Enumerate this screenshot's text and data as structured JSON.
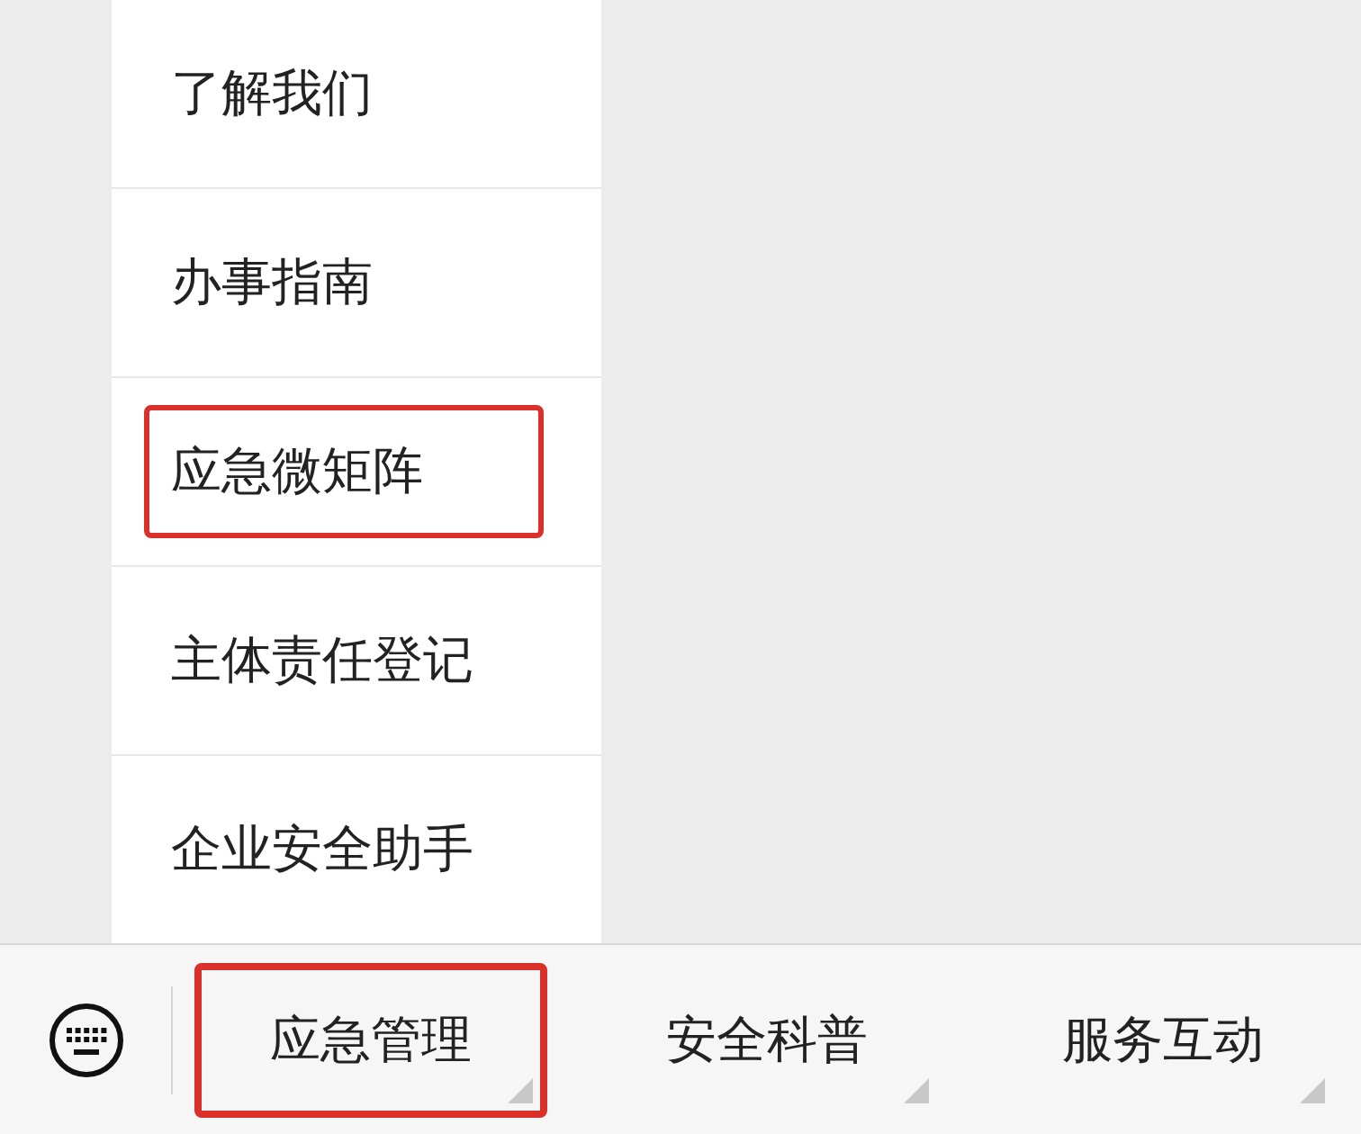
{
  "submenu": {
    "items": [
      {
        "label": "了解我们",
        "highlighted": false
      },
      {
        "label": "办事指南",
        "highlighted": false
      },
      {
        "label": "应急微矩阵",
        "highlighted": true
      },
      {
        "label": "主体责任登记",
        "highlighted": false
      },
      {
        "label": "企业安全助手",
        "highlighted": false
      }
    ]
  },
  "menu_bar": {
    "buttons": [
      {
        "label": "应急管理",
        "highlighted": true
      },
      {
        "label": "安全科普",
        "highlighted": false
      },
      {
        "label": "服务互动",
        "highlighted": false
      }
    ]
  }
}
